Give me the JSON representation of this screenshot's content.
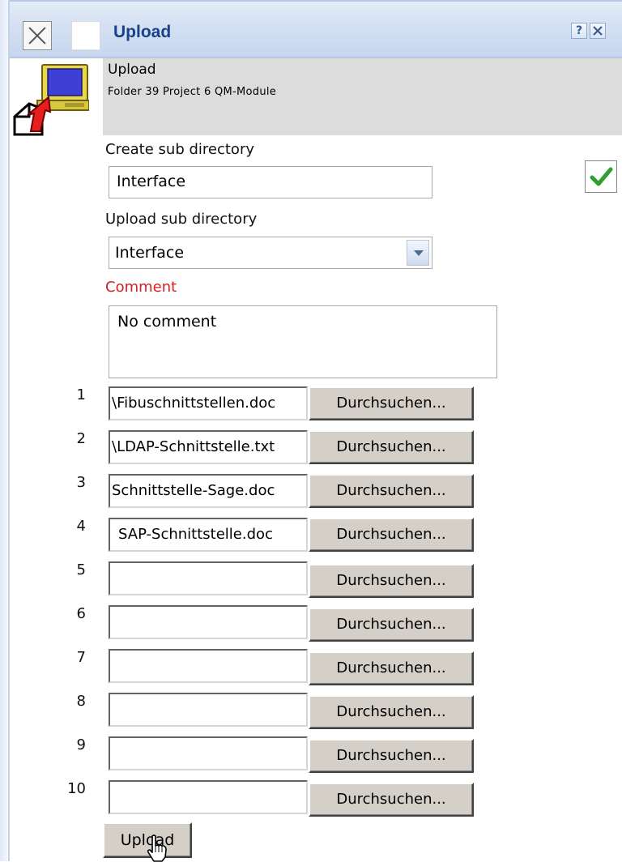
{
  "titlebar": {
    "title": "Upload",
    "help": "?"
  },
  "header": {
    "title": "Upload",
    "path": "Folder 39 Project 6 QM-Module"
  },
  "form": {
    "create_sub_directory_label": "Create sub directory",
    "create_sub_directory_value": "Interface",
    "upload_sub_directory_label": "Upload sub directory",
    "upload_sub_directory_value": "Interface",
    "comment_label": "Comment",
    "comment_value": "No comment"
  },
  "files": [
    {
      "num": "1",
      "value": "\\Fibuschnittstellen.doc"
    },
    {
      "num": "2",
      "value": "\\LDAP-Schnittstelle.txt"
    },
    {
      "num": "3",
      "value": "Schnittstelle-Sage.doc"
    },
    {
      "num": "4",
      "value": "SAP-Schnittstelle.doc"
    },
    {
      "num": "5",
      "value": ""
    },
    {
      "num": "6",
      "value": ""
    },
    {
      "num": "7",
      "value": ""
    },
    {
      "num": "8",
      "value": ""
    },
    {
      "num": "9",
      "value": ""
    },
    {
      "num": "10",
      "value": ""
    }
  ],
  "browse_label": "Durchsuchen...",
  "upload_button": "Upload",
  "colors": {
    "title_text": "#15428b",
    "comment_label": "#d42020",
    "header_band": "#dcdcdc"
  }
}
